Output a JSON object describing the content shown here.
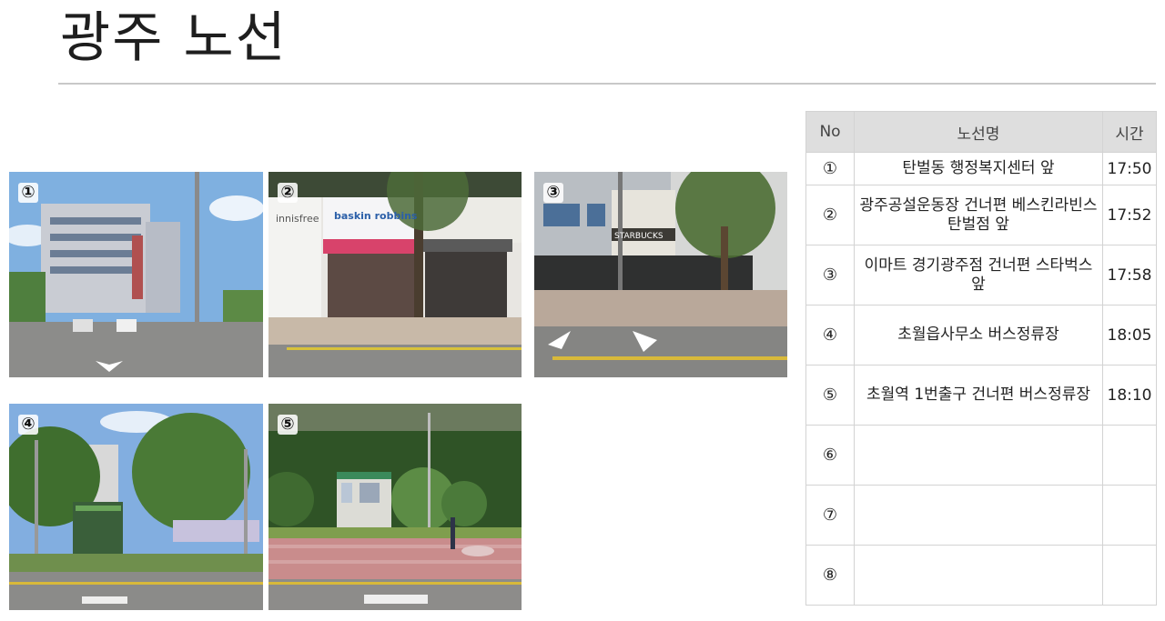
{
  "page": {
    "title": "광주 노선"
  },
  "photos": [
    {
      "badge": "①"
    },
    {
      "badge": "②",
      "signs": [
        "innisfree",
        "baskin robbins"
      ]
    },
    {
      "badge": "③",
      "signs": [
        "STARBUCKS"
      ]
    },
    {
      "badge": "④"
    },
    {
      "badge": "⑤"
    }
  ],
  "table": {
    "headers": {
      "no": "No",
      "name": "노선명",
      "time": "시간"
    },
    "rows": [
      {
        "no": "①",
        "name": "탄벌동 행정복지센터 앞",
        "time": "17:50"
      },
      {
        "no": "②",
        "name": "광주공설운동장 건너편 베스킨라빈스 탄벌점 앞",
        "time": "17:52"
      },
      {
        "no": "③",
        "name": "이마트 경기광주점 건너편 스타벅스 앞",
        "time": "17:58"
      },
      {
        "no": "④",
        "name": "초월읍사무소 버스정류장",
        "time": "18:05"
      },
      {
        "no": "⑤",
        "name": "초월역 1번출구 건너편 버스정류장",
        "time": "18:10"
      },
      {
        "no": "⑥",
        "name": "",
        "time": ""
      },
      {
        "no": "⑦",
        "name": "",
        "time": ""
      },
      {
        "no": "⑧",
        "name": "",
        "time": ""
      }
    ]
  },
  "colors": {
    "rule": "#c8c8c8",
    "header_bg": "#dedede",
    "grid": "#d3d3d3"
  }
}
